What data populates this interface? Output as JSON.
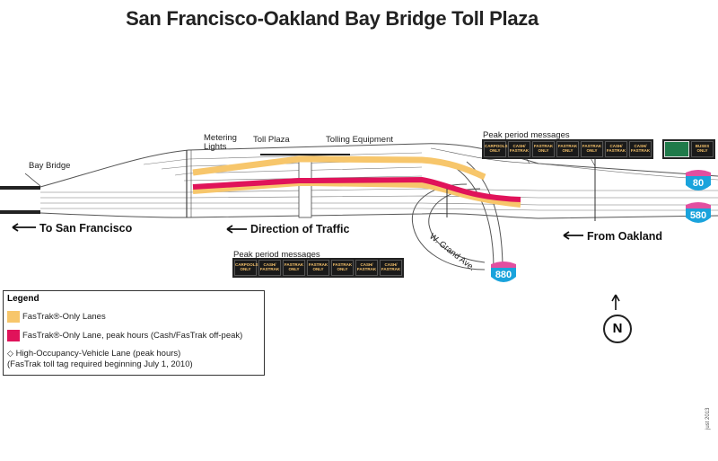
{
  "title": "San Francisco-Oakland Bay Bridge Toll Plaza",
  "labels": {
    "bay_bridge": "Bay Bridge",
    "metering_lights": "Metering\nLights",
    "toll_plaza": "Toll Plaza",
    "tolling_equipment": "Tolling Equipment",
    "peak_messages_top": "Peak period messages",
    "peak_messages_bottom": "Peak period messages",
    "w_grand_ave": "W. Grand Ave.",
    "to_sf": "To  San Francisco",
    "direction": "Direction of Traffic",
    "from_oakland": "From Oakland"
  },
  "shields": {
    "i80": "80",
    "i580": "580",
    "i880": "880"
  },
  "signs_top": [
    "CARPOOLS ONLY",
    "CASH/ FASTRAK",
    "FASTRAK ONLY",
    "FASTRAK ONLY",
    "FASTRAK ONLY",
    "CASH/ FASTRAK",
    "CASH/ FASTRAK"
  ],
  "signs_top_right": "BUSES ONLY",
  "signs_bottom": [
    "CARPOOLS ONLY",
    "CASH/ FASTRAK",
    "FASTRAK ONLY",
    "FASTRAK ONLY",
    "FASTRAK ONLY",
    "CASH/ FASTRAK",
    "CASH/ FASTRAK"
  ],
  "legend": {
    "title": "Legend",
    "fastrak_only": "FasTrak®-Only Lanes",
    "fastrak_peak": "FasTrak®-Only Lane, peak hours (Cash/FasTrak off-peak)",
    "hov_line1": "High-Occupancy-Vehicle Lane (peak hours)",
    "hov_line2": "(FasTrak toll tag required beginning July 1, 2010)"
  },
  "compass": "N",
  "footer": "just 2013",
  "colors": {
    "fastrak_only": "#f7c66b",
    "fastrak_peak": "#e0135a",
    "shield_blue": "#1aa3dc",
    "shield_pink": "#e24fa0"
  }
}
